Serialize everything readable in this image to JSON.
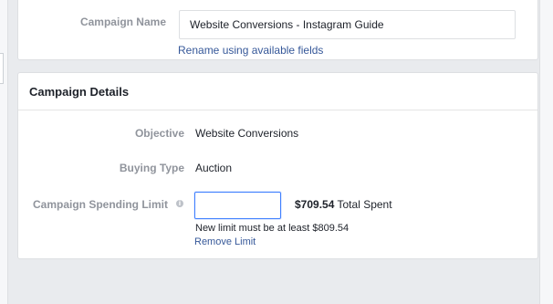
{
  "campaign_name": {
    "label": "Campaign Name",
    "value": "Website Conversions - Instagram Guide",
    "rename_link": "Rename using available fields"
  },
  "campaign_details": {
    "title": "Campaign Details",
    "objective": {
      "label": "Objective",
      "value": "Website Conversions"
    },
    "buying_type": {
      "label": "Buying Type",
      "value": "Auction"
    },
    "spending_limit": {
      "label": "Campaign Spending Limit",
      "info_icon": "info-icon",
      "input_value": "",
      "spent_amount": "$709.54",
      "spent_suffix": " Total Spent",
      "hint": "New limit must be at least $809.54",
      "remove_link": "Remove Limit"
    }
  },
  "colors": {
    "link": "#365899",
    "label": "#90949c",
    "focus_border": "#4080ff",
    "background": "#e9ebee"
  }
}
